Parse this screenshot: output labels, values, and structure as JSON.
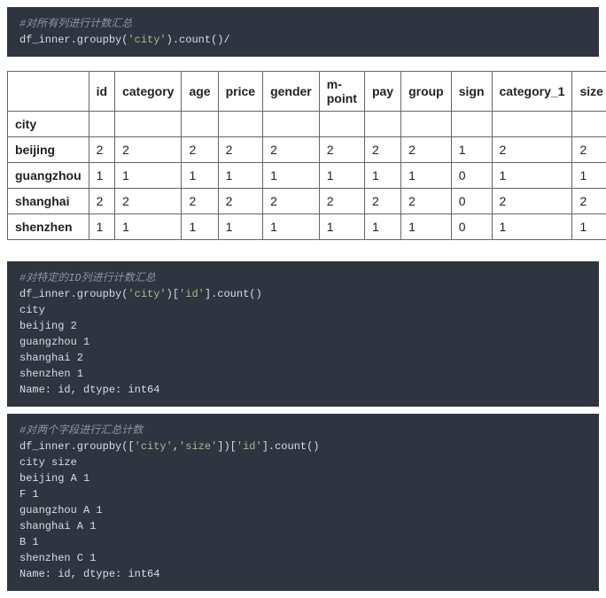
{
  "block1": {
    "comment": "#对所有列进行计数汇总",
    "code_pre": "df_inner.groupby(",
    "code_str": "'city'",
    "code_post": ").count()/"
  },
  "table": {
    "index_name": "city",
    "columns": [
      "id",
      "category",
      "age",
      "price",
      "gender",
      "m-point",
      "pay",
      "group",
      "sign",
      "category_1",
      "size"
    ],
    "rows": [
      {
        "label": "beijing",
        "values": [
          "2",
          "2",
          "2",
          "2",
          "2",
          "2",
          "2",
          "2",
          "1",
          "2",
          "2"
        ]
      },
      {
        "label": "guangzhou",
        "values": [
          "1",
          "1",
          "1",
          "1",
          "1",
          "1",
          "1",
          "1",
          "0",
          "1",
          "1"
        ]
      },
      {
        "label": "shanghai",
        "values": [
          "2",
          "2",
          "2",
          "2",
          "2",
          "2",
          "2",
          "2",
          "0",
          "2",
          "2"
        ]
      },
      {
        "label": "shenzhen",
        "values": [
          "1",
          "1",
          "1",
          "1",
          "1",
          "1",
          "1",
          "1",
          "0",
          "1",
          "1"
        ]
      }
    ]
  },
  "block2": {
    "comment": "#对特定的ID列进行计数汇总",
    "code_pre": "df_inner.groupby(",
    "code_str1": "'city'",
    "code_mid": ")[",
    "code_str2": "'id'",
    "code_post": "].count()",
    "out": [
      "city",
      "beijing 2",
      "guangzhou 1",
      "shanghai 2",
      "shenzhen 1",
      "Name: id, dtype: int64"
    ]
  },
  "block3": {
    "comment": "#对两个字段进行汇总计数",
    "code_pre": "df_inner.groupby([",
    "code_str1": "'city'",
    "code_sep": ",",
    "code_str2": "'size'",
    "code_mid": "])[",
    "code_str3": "'id'",
    "code_post": "].count()",
    "out": [
      "city size",
      "beijing A 1",
      "F 1",
      "guangzhou A 1",
      "shanghai A 1",
      "B 1",
      "shenzhen C 1",
      "Name: id, dtype: int64"
    ]
  }
}
